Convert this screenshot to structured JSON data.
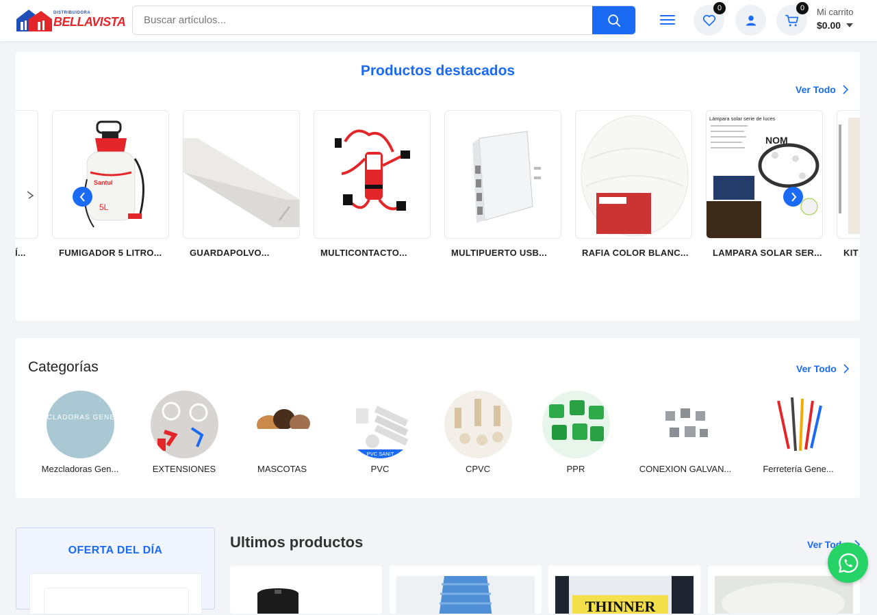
{
  "header": {
    "logo_small": "DISTRIBUIDORA",
    "logo_big": "BELLAVISTA",
    "search_placeholder": "Buscar artículos...",
    "wishlist_count": "0",
    "cart_count": "0",
    "cart_label": "Mi carrito",
    "cart_total": "$0.00"
  },
  "featured": {
    "title": "Productos destacados",
    "view_all": "Ver Todo",
    "products": [
      {
        "name": "Í..."
      },
      {
        "name": "FUMIGADOR 5 LITRO..."
      },
      {
        "name": "GUARDAPOLVO..."
      },
      {
        "name": "MULTICONTACTO..."
      },
      {
        "name": "MULTIPUERTO USB..."
      },
      {
        "name": "RAFIA COLOR BLANC..."
      },
      {
        "name": "LAMPARA SOLAR SER..."
      },
      {
        "name": "KIT"
      }
    ],
    "fumigator_capacity": "5L",
    "brand": "Santul",
    "lamp_title": "Lámpara solar serie de luces",
    "lamp_logo": "NOM"
  },
  "categories": {
    "title": "Categorías",
    "view_all": "Ver Todo",
    "items": [
      {
        "name": "Mezcladoras Gen...",
        "thumb_text": "MEZCLADORAS GENERAL"
      },
      {
        "name": "EXTENSIONES"
      },
      {
        "name": "MASCOTAS"
      },
      {
        "name": "PVC",
        "thumb_text": "PVC SANIT"
      },
      {
        "name": "CPVC"
      },
      {
        "name": "PPR"
      },
      {
        "name": "CONEXION GALVAN..."
      },
      {
        "name": "Ferretería Gene..."
      }
    ]
  },
  "offer": {
    "title": "OFERTA DEL DÍA"
  },
  "latest": {
    "title": "Ultimos productos",
    "view_all": "Ver Todo",
    "thinner_label": "THINNER"
  },
  "colors": {
    "primary": "#1a6af4",
    "logo_red": "#e3262a",
    "whatsapp": "#25d366"
  }
}
